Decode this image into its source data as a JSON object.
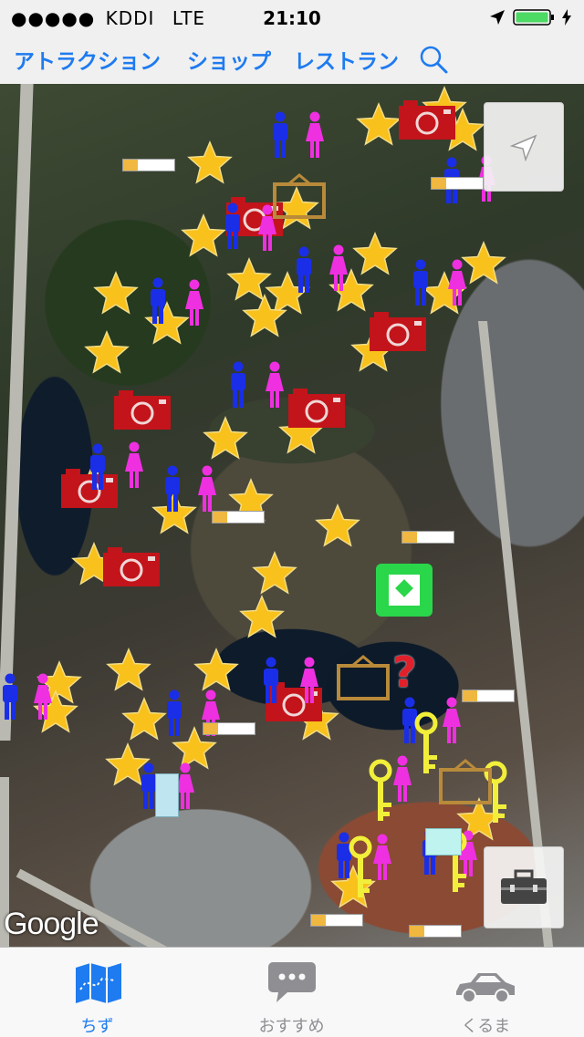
{
  "status_bar": {
    "signal_dots": "●●●●●",
    "carrier": "KDDI",
    "network": "LTE",
    "time": "21:10"
  },
  "nav": {
    "attraction_label": "アトラクション",
    "shop_label": "ショップ",
    "restaurant_label": "レストラン"
  },
  "map": {
    "attribution": "Google",
    "colors": {
      "star": "#f9c11b",
      "male_icon": "#1a2ee8",
      "female_icon": "#ee30e0",
      "camera": "#c2141a",
      "key": "#f2ef3a",
      "info_box": "#2ad64a"
    }
  },
  "tabs": [
    {
      "label": "ちず",
      "icon": "map-icon",
      "selected": true
    },
    {
      "label": "おすすめ",
      "icon": "chat-bubble-icon",
      "selected": false
    },
    {
      "label": "くるま",
      "icon": "car-icon",
      "selected": false
    }
  ],
  "accent_color": "#1e7bf0"
}
